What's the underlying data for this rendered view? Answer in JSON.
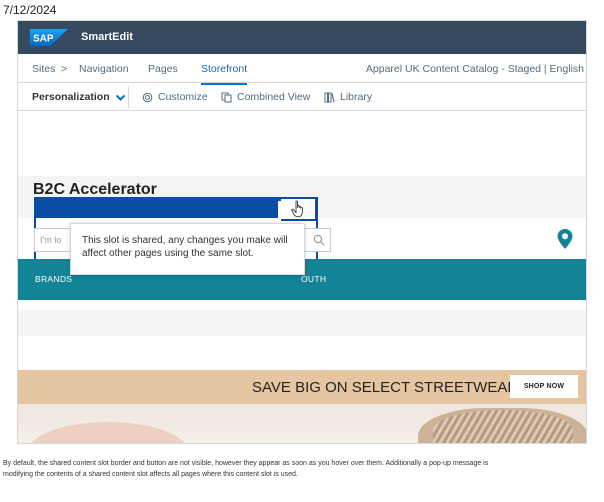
{
  "date": "7/12/2024",
  "topbar": {
    "logo_text": "SAP",
    "app_name": "SmartEdit"
  },
  "nav": {
    "sites": "Sites",
    "separator": ">",
    "navigation": "Navigation",
    "pages": "Pages",
    "storefront": "Storefront",
    "catalog": "Apparel UK Content Catalog - Staged | English"
  },
  "toolbar": {
    "personalization": "Personalization",
    "customize": "Customize",
    "combined_view": "Combined View",
    "library": "Library"
  },
  "storefront": {
    "brand_title": "B2C Accelerator",
    "search_placeholder": "I'm lo",
    "nav_left": "BRANDS",
    "nav_right": "OUTH",
    "promo_text": "SAVE BIG ON SELECT STREETWEAR",
    "promo_button": "SHOP NOW"
  },
  "popover": {
    "text": "This slot is shared, any changes you make will affect other pages using the same slot."
  },
  "caption": {
    "line1": "By default, the shared content slot border and button are not visible, however they appear as soon as you hover over them. Additionally a pop-up message is",
    "line2": "modifying the contents of a shared content slot affects all pages where this content slot is used."
  },
  "colors": {
    "shell": "#354a5f",
    "accent": "#0a6ed1",
    "slot_border": "#0b4da2",
    "nav_band": "#138498",
    "promo_band": "#e6c5a2"
  },
  "icons": [
    "sap-logo",
    "chevron-down-icon",
    "customize-icon",
    "combined-view-icon",
    "library-icon",
    "hand-pointer-icon",
    "search-icon",
    "location-pin-icon"
  ]
}
